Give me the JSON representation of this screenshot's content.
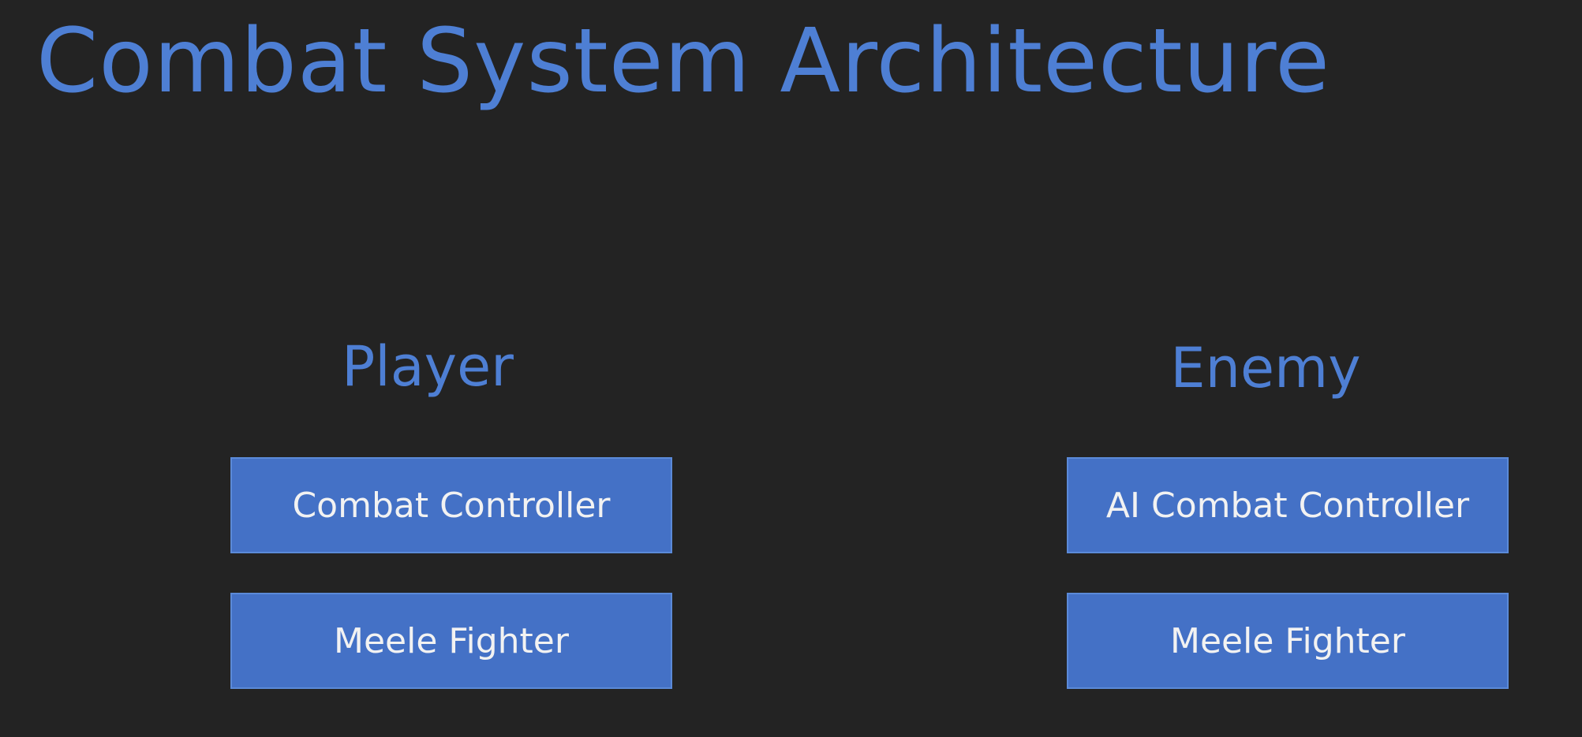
{
  "title": "Combat System Architecture",
  "colors": {
    "background": "#232323",
    "accent_text": "#4E7FD4",
    "box_fill": "#4471C6",
    "box_border": "#5B8AD8",
    "box_text": "#F2F2F2"
  },
  "columns": [
    {
      "label": "Player",
      "boxes": [
        "Combat Controller",
        "Meele Fighter"
      ]
    },
    {
      "label": "Enemy",
      "boxes": [
        "AI Combat Controller",
        "Meele Fighter"
      ]
    }
  ]
}
